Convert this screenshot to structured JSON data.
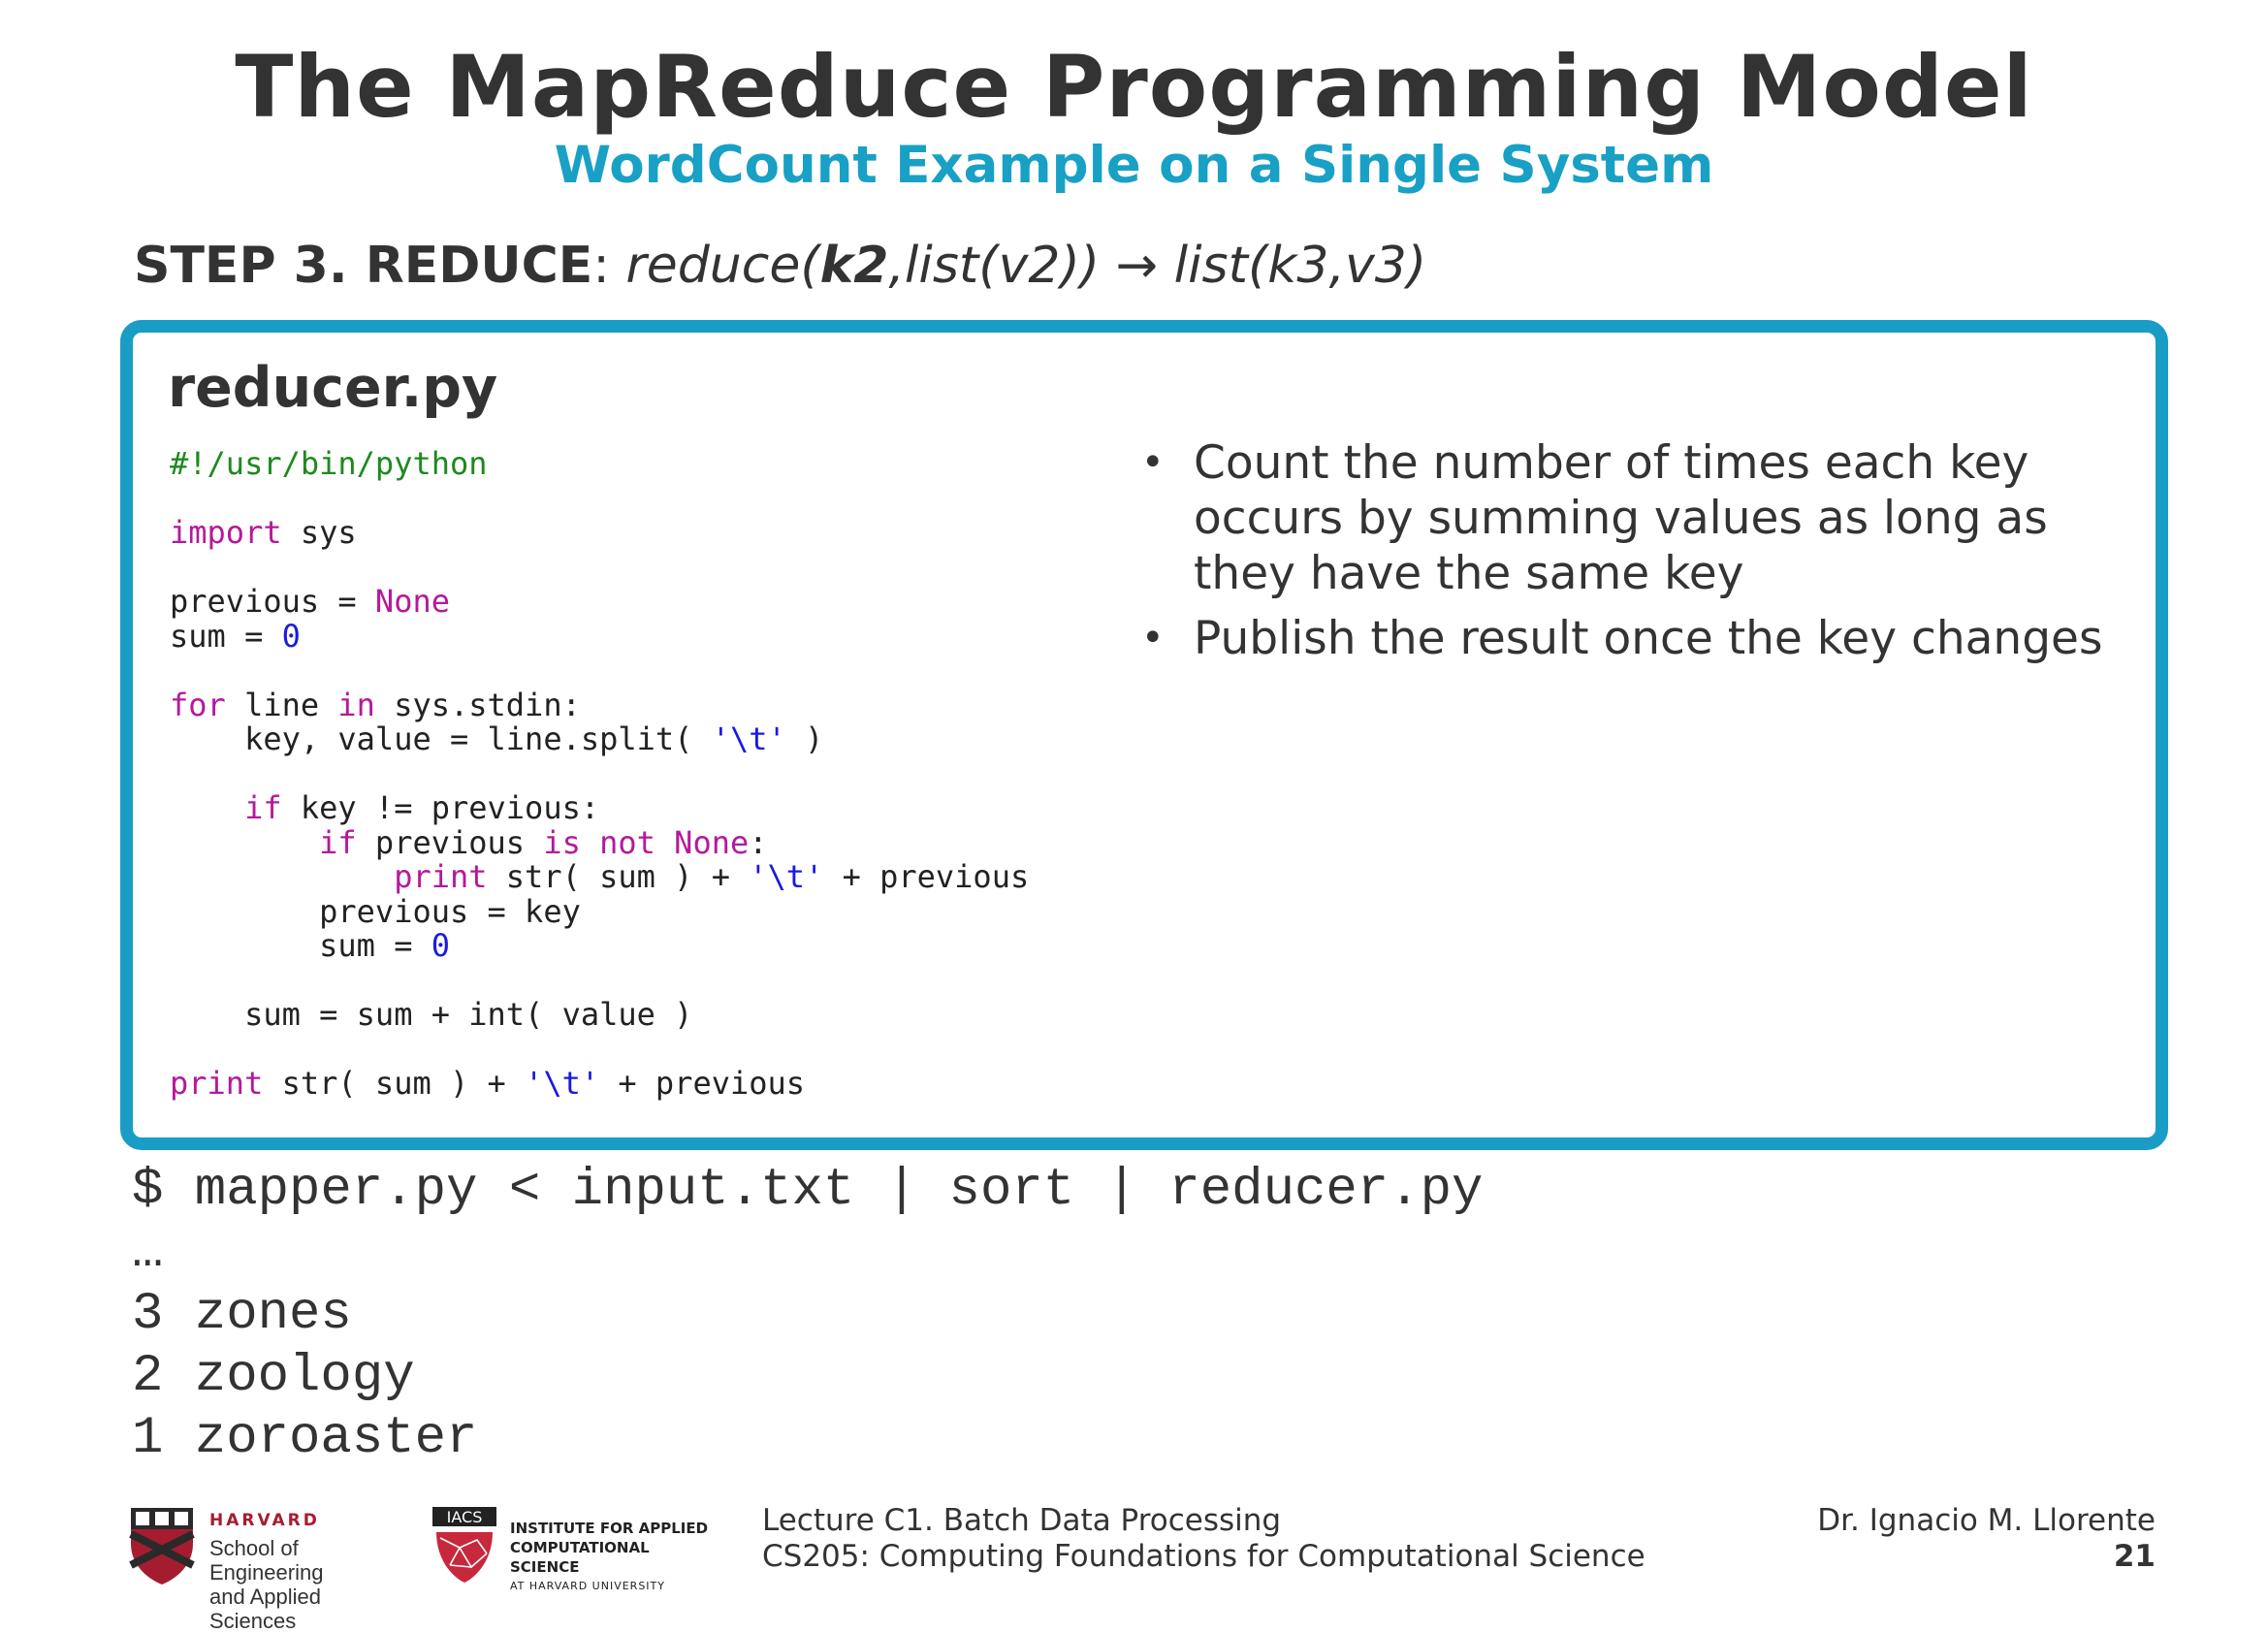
{
  "slide": {
    "title": "The MapReduce Programming Model",
    "subtitle": "WordCount Example on a Single System",
    "step_label": "STEP 3. REDUCE",
    "step_separator": ": ",
    "formula_pre": "reduce(",
    "formula_bold": "k2",
    "formula_post": ",list(v2)) → list(k3,v3)"
  },
  "panel": {
    "file_name": "reducer.py",
    "code_lines": [
      [
        [
          "cm",
          "#!/usr/bin/python"
        ]
      ],
      [],
      [
        [
          "kw",
          "import"
        ],
        [
          "t",
          " sys"
        ]
      ],
      [],
      [
        [
          "t",
          "previous = "
        ],
        [
          "kw",
          "None"
        ]
      ],
      [
        [
          "t",
          "sum = "
        ],
        [
          "num",
          "0"
        ]
      ],
      [],
      [
        [
          "kw",
          "for"
        ],
        [
          "t",
          " line "
        ],
        [
          "kw",
          "in"
        ],
        [
          "t",
          " sys.stdin:"
        ]
      ],
      [
        [
          "t",
          "    key, value = line.split( "
        ],
        [
          "str",
          "'\\t'"
        ],
        [
          "t",
          " )"
        ]
      ],
      [],
      [
        [
          "t",
          "    "
        ],
        [
          "kw",
          "if"
        ],
        [
          "t",
          " key != previous:"
        ]
      ],
      [
        [
          "t",
          "        "
        ],
        [
          "kw",
          "if"
        ],
        [
          "t",
          " previous "
        ],
        [
          "kw",
          "is not None"
        ],
        [
          "t",
          ":"
        ]
      ],
      [
        [
          "t",
          "            "
        ],
        [
          "kw",
          "print"
        ],
        [
          "t",
          " str( sum ) + "
        ],
        [
          "str",
          "'\\t'"
        ],
        [
          "t",
          " + previous"
        ]
      ],
      [
        [
          "t",
          "        previous = key"
        ]
      ],
      [
        [
          "t",
          "        sum = "
        ],
        [
          "num",
          "0"
        ]
      ],
      [],
      [
        [
          "t",
          "    sum = sum + int( value )"
        ]
      ],
      [],
      [
        [
          "kw",
          "print"
        ],
        [
          "t",
          " str( sum ) + "
        ],
        [
          "str",
          "'\\t'"
        ],
        [
          "t",
          " + previous"
        ]
      ]
    ],
    "bullets": [
      "Count the number of times each key occurs by summing values as long as they have the same key",
      "Publish the result once the key changes"
    ]
  },
  "terminal": {
    "command": "$ mapper.py < input.txt | sort | reducer.py",
    "ellipsis": "…",
    "results": [
      "3 zones",
      "2 zoology",
      "1 zoroaster"
    ]
  },
  "footer": {
    "harvard_label": "HARVARD",
    "seas_line1": "School of Engineering",
    "seas_line2": "and Applied Sciences",
    "iacs_badge": "IACS",
    "iacs_line1": "INSTITUTE FOR APPLIED",
    "iacs_line2": "COMPUTATIONAL SCIENCE",
    "iacs_line3": "AT HARVARD UNIVERSITY",
    "lecture": "Lecture C1. Batch Data Processing",
    "course": "CS205: Computing Foundations for Computational Science",
    "author": "Dr. Ignacio M. Llorente",
    "page": "21"
  },
  "colors": {
    "accent": "#1a9dc5",
    "text": "#333333",
    "comment": "#1d8a1d",
    "keyword": "#b5199b",
    "literal": "#1a1ae0",
    "harvard_crimson": "#a51c30"
  }
}
